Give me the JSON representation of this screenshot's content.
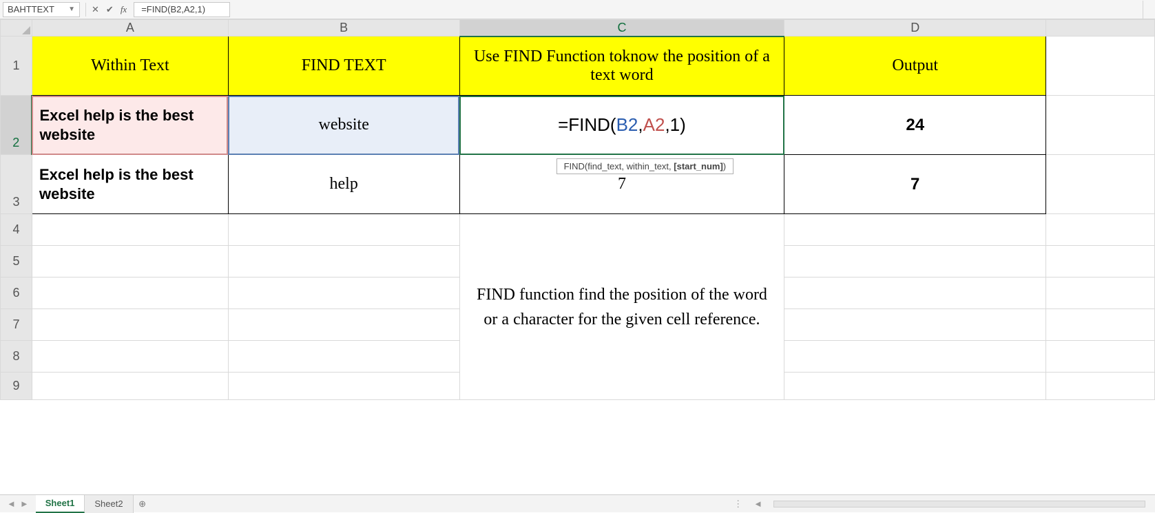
{
  "formulaBar": {
    "nameBox": "BAHTTEXT",
    "formula": "=FIND(B2,A2,1)"
  },
  "columns": [
    "A",
    "B",
    "C",
    "D"
  ],
  "rowNumbers": [
    "1",
    "2",
    "3",
    "4",
    "5",
    "6",
    "7",
    "8",
    "9"
  ],
  "headerRow": {
    "A": "Within Text",
    "B": "FIND TEXT",
    "C": "Use FIND Function toknow the position of a text word",
    "D": "Output"
  },
  "row2": {
    "A": "Excel help is the best website",
    "B": "website",
    "C_prefix": "=FIND(",
    "C_b": "B2",
    "C_sep1": ",",
    "C_a": "A2",
    "C_sep2": ",1",
    "C_suffix": ")",
    "D": "24"
  },
  "row3": {
    "A": "Excel help is the best website",
    "B": "help",
    "C": "7",
    "D": "7"
  },
  "tooltip": {
    "fn": "FIND",
    "args_plain": "(find_text, within_text, ",
    "args_bold": "[start_num]",
    "args_close": ")"
  },
  "note": "FIND function find the position of the word or a character for the given cell reference.",
  "tabs": {
    "sheet1": "Sheet1",
    "sheet2": "Sheet2"
  }
}
